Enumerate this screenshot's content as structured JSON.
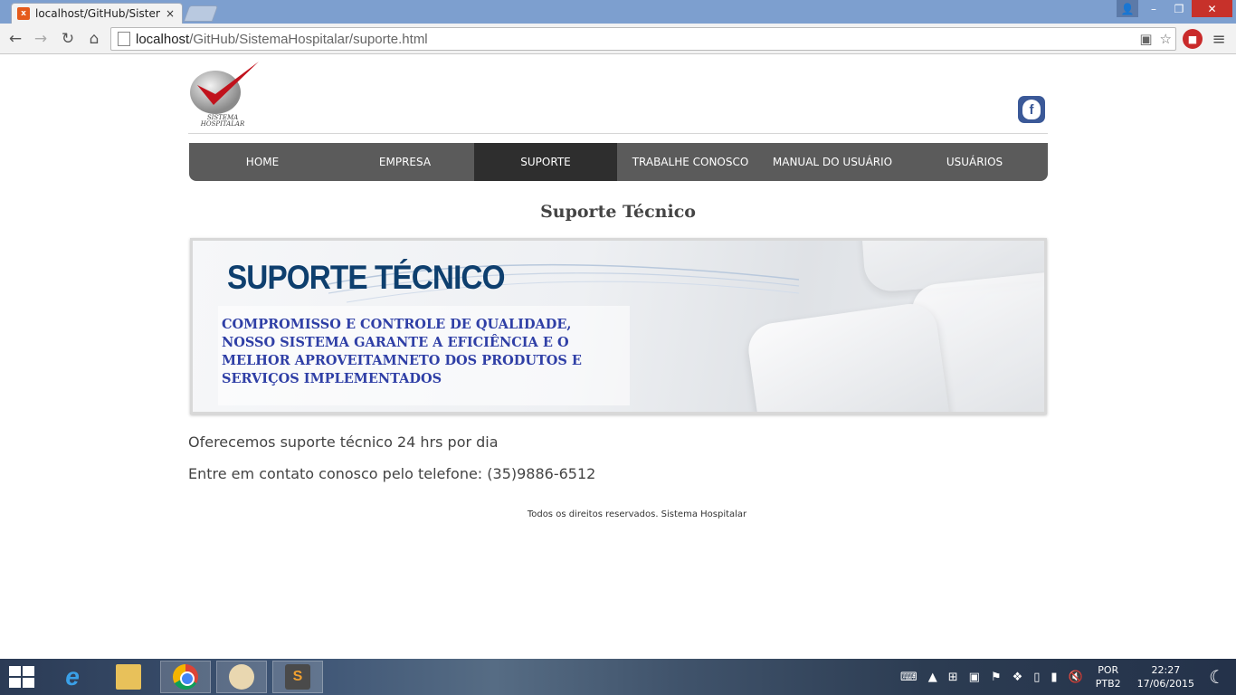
{
  "browser": {
    "tab_title": "localhost/GitHub/Sistema",
    "tab_close": "×",
    "url_host": "localhost",
    "url_path": "/GitHub/SistemaHospitalar/suporte.html",
    "window_buttons": {
      "user": "👤",
      "minimize": "–",
      "maximize": "❐",
      "close": "✕"
    }
  },
  "site": {
    "logo_text_line1": "SISTEMA",
    "logo_text_line2": "HOSPITALAR",
    "facebook_letter": "f",
    "nav": [
      {
        "label": "HOME",
        "active": false
      },
      {
        "label": "EMPRESA",
        "active": false
      },
      {
        "label": "SUPORTE",
        "active": true
      },
      {
        "label": "TRABALHE CONOSCO",
        "active": false
      },
      {
        "label": "MANUAL DO USUÁRIO",
        "active": false
      },
      {
        "label": "USUÁRIOS",
        "active": false
      }
    ],
    "page_title": "Suporte Técnico",
    "banner": {
      "title": "SUPORTE TÉCNICO",
      "lines": [
        "COMPROMISSO E CONTROLE DE QUALIDADE,",
        "NOSSO SISTEMA GARANTE A EFICIÊNCIA E O",
        "MELHOR APROVEITAMNETO DOS PRODUTOS E",
        "SERVIÇOS IMPLEMENTADOS"
      ]
    },
    "paragraph1": "Oferecemos suporte técnico 24 hrs por dia",
    "paragraph2": "Entre em contato conosco pelo telefone: (35)9886-6512",
    "footer": "Todos os direitos reservados. Sistema Hospitalar"
  },
  "taskbar": {
    "language_line1": "POR",
    "language_line2": "PTB2",
    "time": "22:27",
    "date": "17/06/2015"
  },
  "colors": {
    "nav_bg": "#5b5b5b",
    "nav_active": "#2e2e2e",
    "banner_title": "#0e3f6e",
    "banner_text": "#2f3fa6",
    "facebook": "#3b5998"
  }
}
